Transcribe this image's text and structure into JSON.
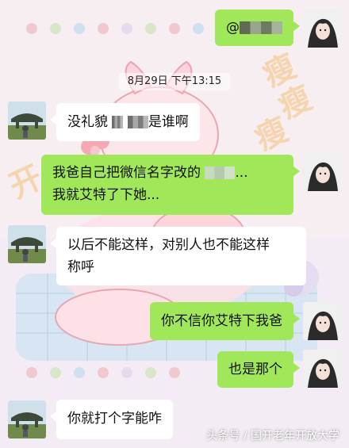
{
  "messages": [
    {
      "id": "m1",
      "side": "right",
      "text_prefix": "@",
      "text_suffix": ""
    },
    {
      "id": "m2",
      "text_prefix": "没礼貌",
      "text_suffix": "是谁啊"
    },
    {
      "id": "m3",
      "line1_prefix": "我爸自己把微信名字改的",
      "line1_suffix": "...",
      "line2": "我就艾特了下她..."
    },
    {
      "id": "m4",
      "line1": "以后不能这样，对别人也不能这样",
      "line2": "称呼"
    },
    {
      "id": "m5",
      "text": "你不信你艾特下我爸"
    },
    {
      "id": "m6",
      "text": "也是那个"
    },
    {
      "id": "m7",
      "text": "你就打个字能咋"
    }
  ],
  "timestamp": "8月29日 下午13:15",
  "watermark": "头条号 / 国开老年开放大学",
  "colors": {
    "sent_bubble": "#a0e75a",
    "received_bubble": "#ffffff"
  }
}
